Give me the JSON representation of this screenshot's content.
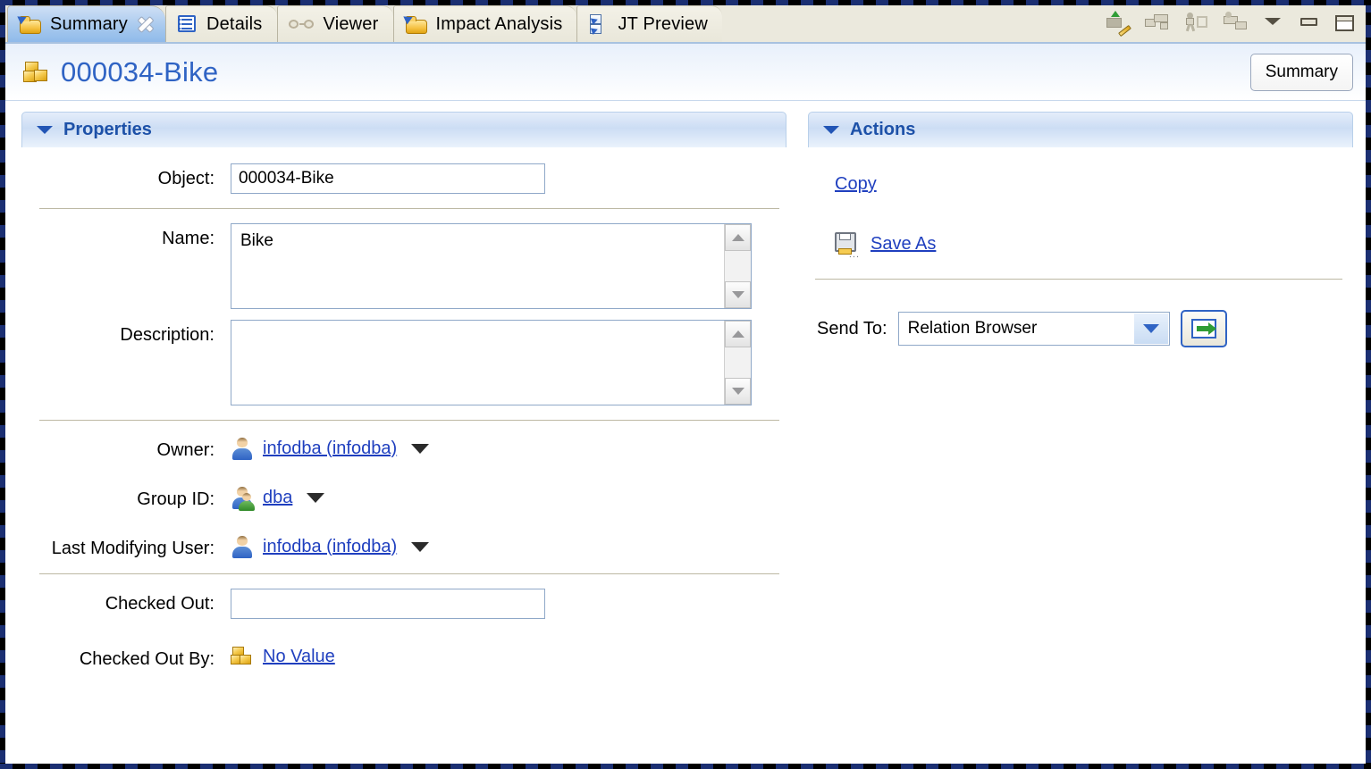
{
  "window": {
    "tabs": [
      {
        "label": "Summary",
        "icon": "folder-arrow-icon",
        "active": true,
        "closable": true
      },
      {
        "label": "Details",
        "icon": "details-list-icon",
        "active": false,
        "closable": false
      },
      {
        "label": "Viewer",
        "icon": "glasses-icon",
        "active": false,
        "closable": false
      },
      {
        "label": "Impact Analysis",
        "icon": "folder-arrow-icon",
        "active": false,
        "closable": false
      },
      {
        "label": "JT Preview",
        "icon": "jt-preview-icon",
        "active": false,
        "closable": false
      }
    ],
    "toolbar": [
      {
        "name": "edit-properties-icon",
        "enabled": true
      },
      {
        "name": "copy-relation-icon",
        "enabled": false
      },
      {
        "name": "run-workflow-icon",
        "enabled": false
      },
      {
        "name": "assign-icon",
        "enabled": false
      }
    ],
    "controls": [
      {
        "name": "view-menu-chevron-icon"
      },
      {
        "name": "minimize-icon"
      },
      {
        "name": "maximize-icon"
      }
    ]
  },
  "header": {
    "icon": "cubes-icon",
    "title": "000034-Bike",
    "view_button": "Summary"
  },
  "properties": {
    "section_title": "Properties",
    "rows": [
      {
        "label": "Object:",
        "type": "text",
        "value": "000034-Bike"
      },
      {
        "label": "Name:",
        "type": "textarea",
        "value": "Bike"
      },
      {
        "label": "Description:",
        "type": "textarea",
        "value": ""
      },
      {
        "label": "Owner:",
        "type": "link",
        "value": "infodba (infodba)",
        "icon": "user-icon"
      },
      {
        "label": "Group ID:",
        "type": "link",
        "value": "dba",
        "icon": "user-group-icon"
      },
      {
        "label": "Last Modifying User:",
        "type": "link",
        "value": "infodba (infodba)",
        "icon": "user-icon"
      },
      {
        "label": "Checked Out:",
        "type": "text",
        "value": ""
      },
      {
        "label": "Checked Out By:",
        "type": "link",
        "value": "No Value",
        "icon": "cubes-icon"
      }
    ]
  },
  "actions": {
    "section_title": "Actions",
    "copy_label": "Copy",
    "save_as_label": "Save As",
    "save_as_icon": "floppy-disk-icon",
    "send_to_label": "Send To:",
    "send_to_value": "Relation Browser",
    "send_to_go_icon": "go-arrow-icon"
  },
  "colors": {
    "link": "#1f3fbf",
    "title": "#2f63c4",
    "section_title": "#1d51a8",
    "tab_active_bg": "#a9caee",
    "tabbar_bg": "#ebe9dd",
    "separator": "#bdb8a4"
  }
}
